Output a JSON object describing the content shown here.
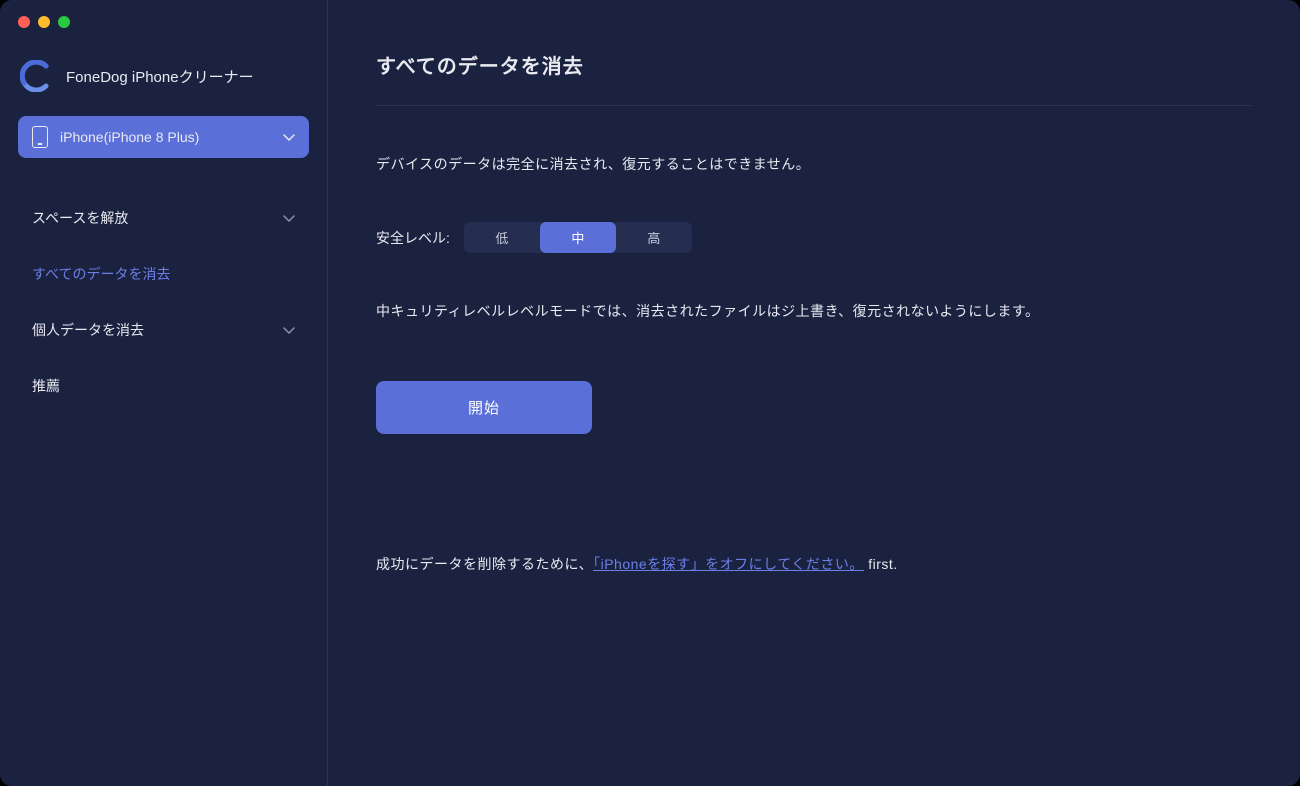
{
  "app": {
    "title": "FoneDog iPhoneクリーナー"
  },
  "device": {
    "label": "iPhone(iPhone 8 Plus)"
  },
  "sidebar": {
    "items": [
      {
        "label": "スペースを解放",
        "expandable": true,
        "active": false
      },
      {
        "label": "すべてのデータを消去",
        "expandable": false,
        "active": true
      },
      {
        "label": "個人データを消去",
        "expandable": true,
        "active": false
      },
      {
        "label": "推薦",
        "expandable": false,
        "active": false
      }
    ]
  },
  "main": {
    "title": "すべてのデータを消去",
    "warning": "デバイスのデータは完全に消去され、復元することはできません。",
    "security_level": {
      "label": "安全レベル:",
      "options": [
        "低",
        "中",
        "高"
      ],
      "selected": "中"
    },
    "description": "中キュリティレベルレベルモードでは、消去されたファイルはジ上書き、復元されないようにします。",
    "start_label": "開始",
    "footer": {
      "prefix": "成功にデータを削除するために、",
      "link": "「iPhoneを探す」をオフにしてください。",
      "suffix": " first."
    }
  }
}
